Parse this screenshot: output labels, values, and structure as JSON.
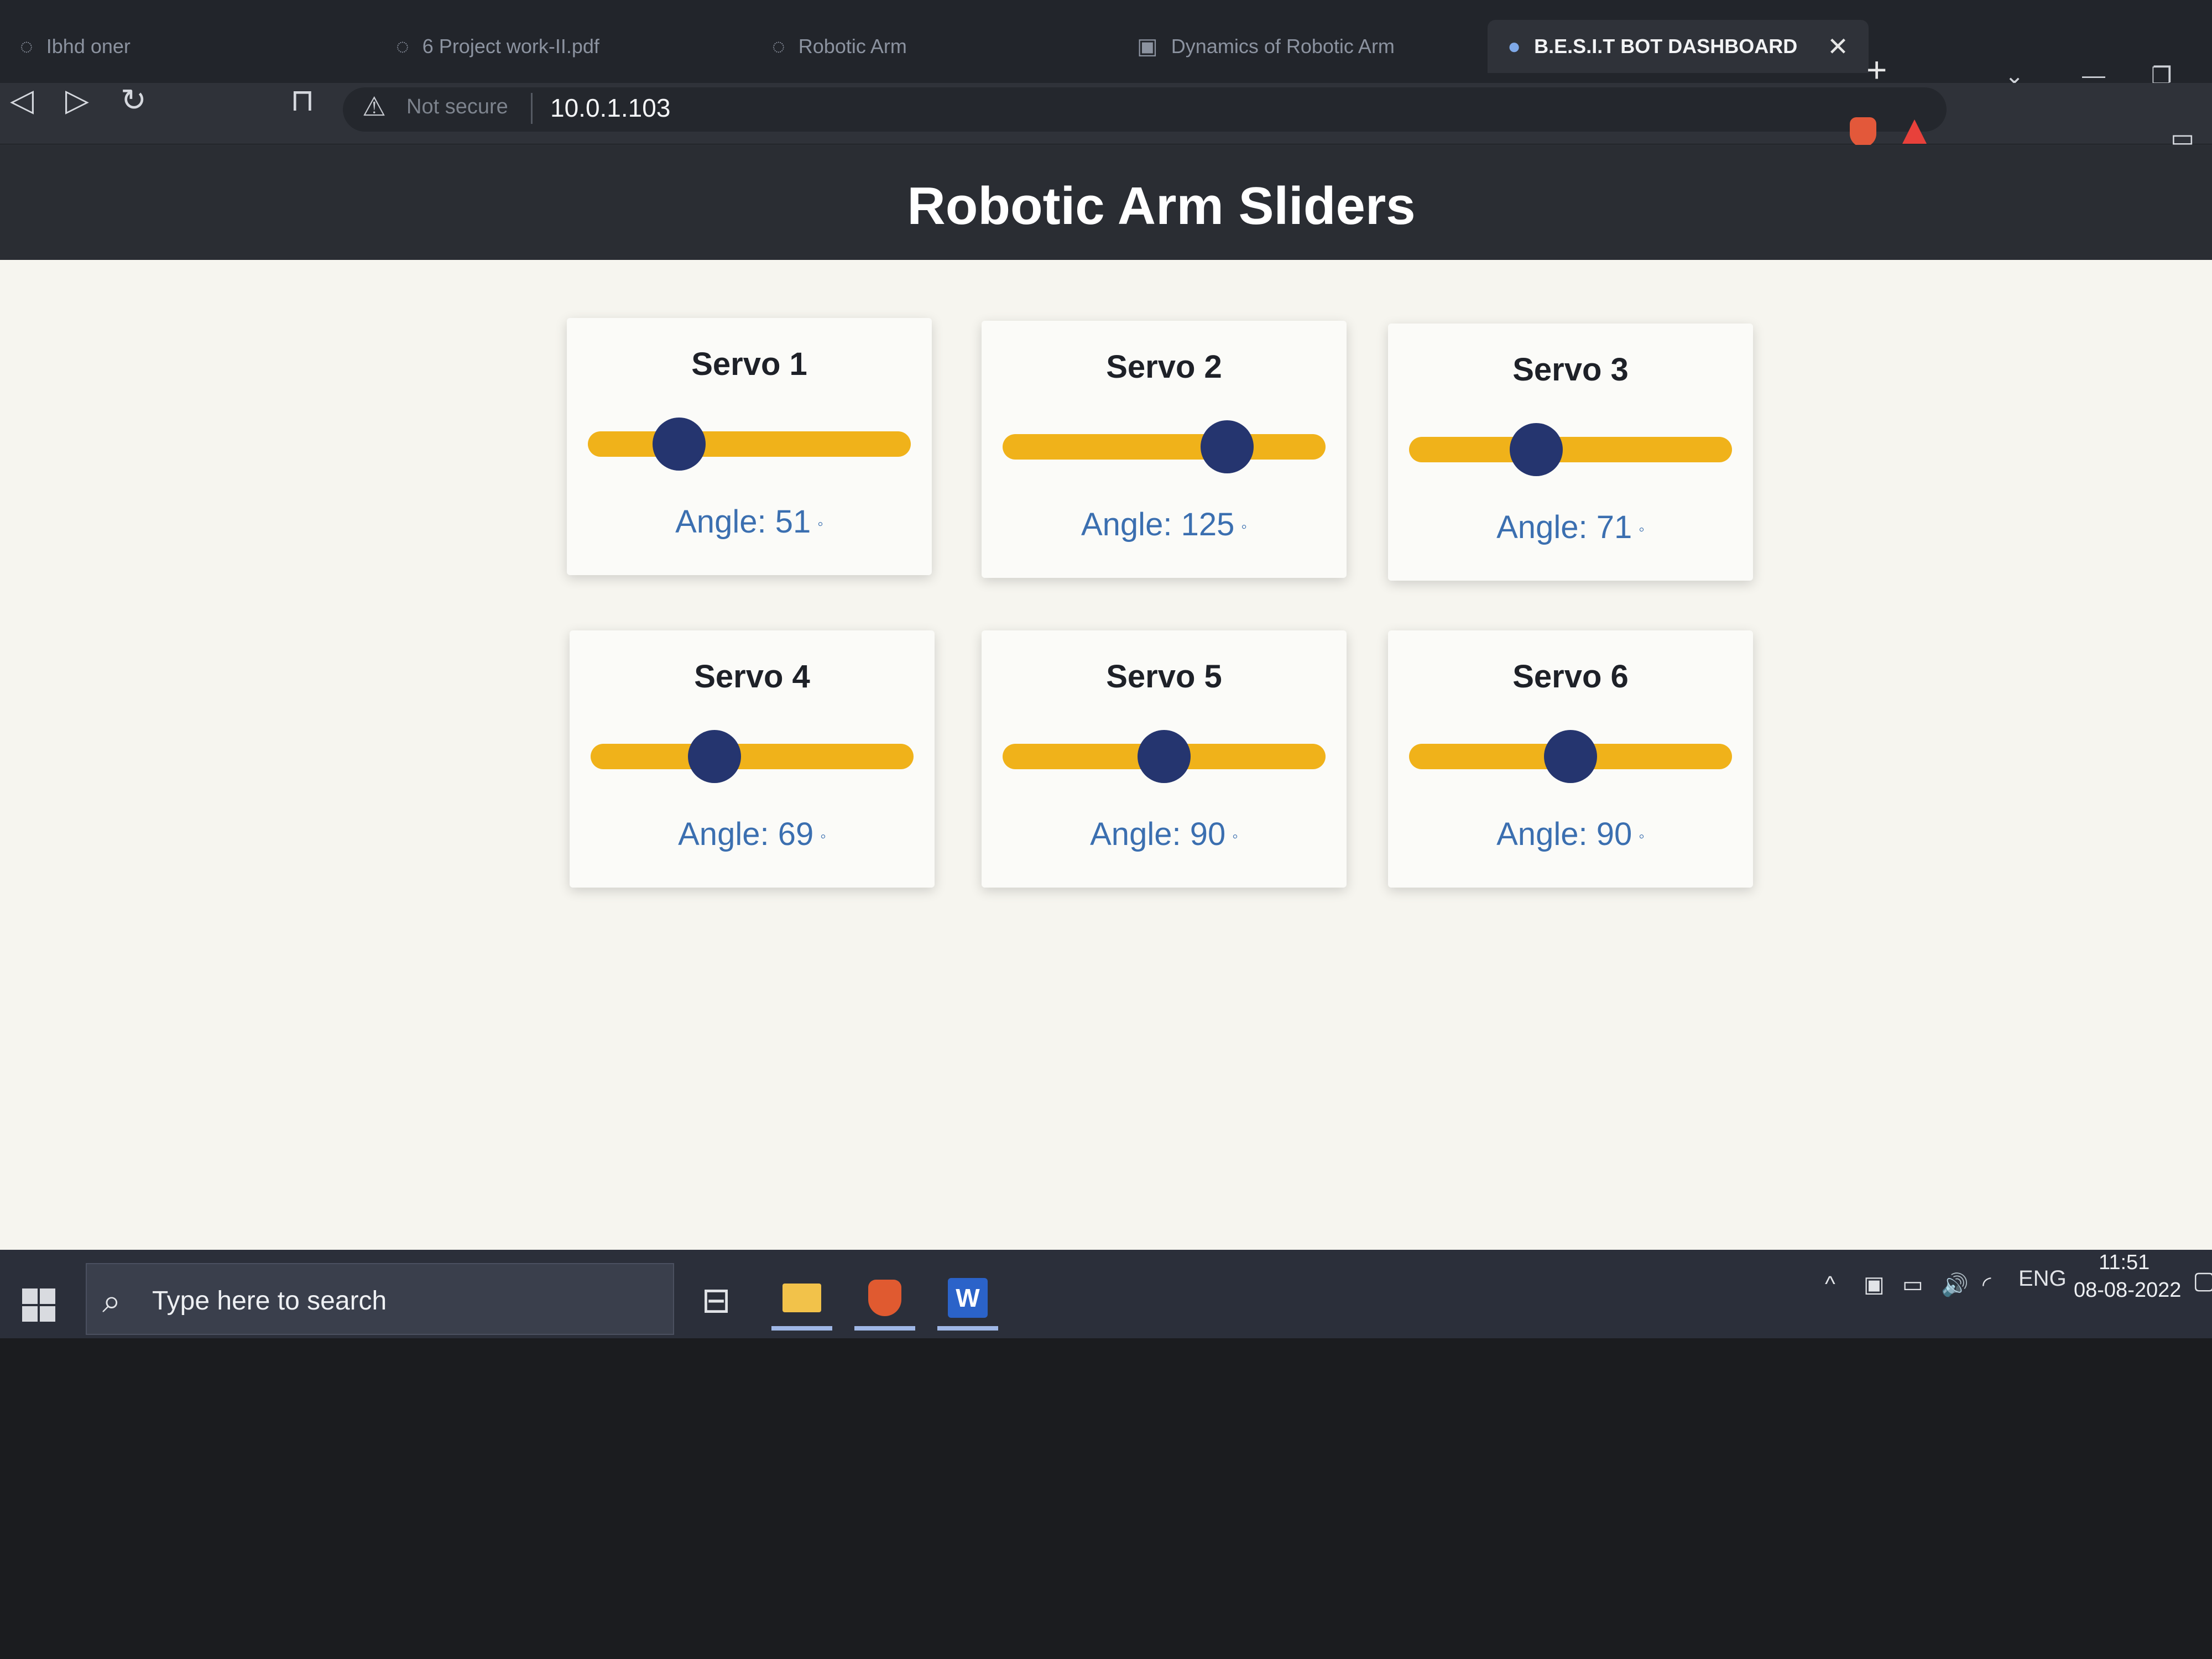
{
  "browser": {
    "tabs": [
      {
        "label": "Ibhd oner",
        "icon": "page-icon"
      },
      {
        "label": "6 Project work-II.pdf",
        "icon": "page-icon"
      },
      {
        "label": "Robotic Arm",
        "icon": "page-icon"
      },
      {
        "label": "Dynamics of Robotic Arm",
        "icon": "site-icon"
      },
      {
        "label": "B.E.S.I.T BOT DASHBOARD",
        "icon": "site-icon"
      }
    ],
    "new_tab": "+",
    "address": {
      "security": "Not secure",
      "url": "10.0.1.103"
    }
  },
  "page": {
    "title": "Robotic Arm Sliders",
    "angle_prefix": "Angle:",
    "degree_symbol": "◦",
    "slider_range": [
      0,
      180
    ],
    "servos": [
      {
        "name": "Servo 1",
        "angle": 51
      },
      {
        "name": "Servo 2",
        "angle": 125
      },
      {
        "name": "Servo 3",
        "angle": 71
      },
      {
        "name": "Servo 4",
        "angle": 69
      },
      {
        "name": "Servo 5",
        "angle": 90
      },
      {
        "name": "Servo 6",
        "angle": 90
      }
    ],
    "colors": {
      "track": "#f0b21a",
      "thumb": "#25356f",
      "angle_text": "#3b6fb0",
      "header": "#2a2d33"
    }
  },
  "taskbar": {
    "search_placeholder": "Type here to search",
    "language": "ENG",
    "time": "11:51",
    "date": "08-08-2022"
  }
}
